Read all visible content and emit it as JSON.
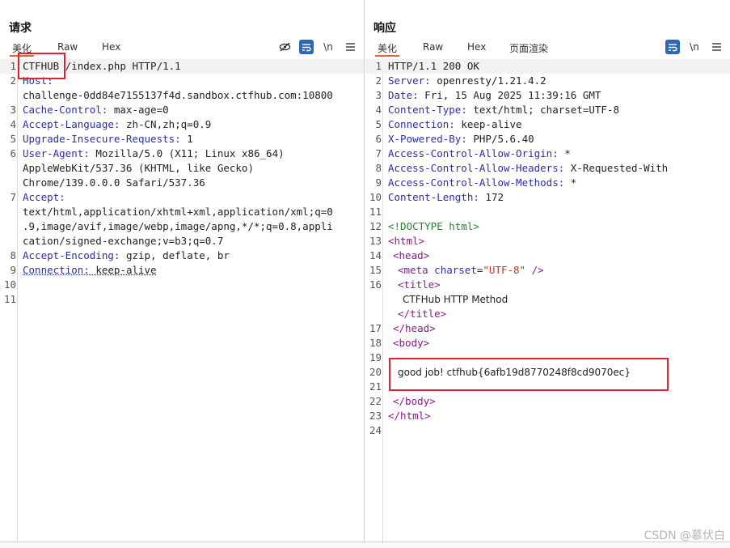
{
  "request": {
    "title": "请求",
    "tabs": [
      "美化",
      "Raw",
      "Hex"
    ],
    "active_tab": "美化",
    "icons": [
      "eye-slash-icon",
      "wrap-icon",
      "newline-icon",
      "menu-icon"
    ],
    "newline_label": "\\n",
    "line_numbers": [
      "1",
      "2",
      "",
      "3",
      "4",
      "5",
      "6",
      "",
      "",
      "7",
      "",
      "",
      "",
      "8",
      "9",
      "10",
      "11"
    ],
    "lines": [
      {
        "k": "",
        "v": "CTFHUB /index.php HTTP/1.1"
      },
      {
        "k": "Host:",
        "v": ""
      },
      {
        "k": "",
        "v": "challenge-0dd84e7155137f4d.sandbox.ctfhub.com:10800"
      },
      {
        "k": "Cache-Control:",
        "v": " max-age=0"
      },
      {
        "k": "Accept-Language:",
        "v": " zh-CN,zh;q=0.9"
      },
      {
        "k": "Upgrade-Insecure-Requests:",
        "v": " 1"
      },
      {
        "k": "User-Agent:",
        "v": " Mozilla/5.0 (X11; Linux x86_64)"
      },
      {
        "k": "",
        "v": "AppleWebKit/537.36 (KHTML, like Gecko)"
      },
      {
        "k": "",
        "v": "Chrome/139.0.0.0 Safari/537.36"
      },
      {
        "k": "Accept:",
        "v": ""
      },
      {
        "k": "",
        "v": "text/html,application/xhtml+xml,application/xml;q=0"
      },
      {
        "k": "",
        "v": ".9,image/avif,image/webp,image/apng,*/*;q=0.8,appli"
      },
      {
        "k": "",
        "v": "cation/signed-exchange;v=b3;q=0.7"
      },
      {
        "k": "Accept-Encoding:",
        "v": " gzip, deflate, br"
      },
      {
        "k": "Connection:",
        "v": " keep-alive"
      },
      {
        "k": "",
        "v": ""
      },
      {
        "k": "",
        "v": ""
      }
    ]
  },
  "response": {
    "title": "响应",
    "tabs": [
      "美化",
      "Raw",
      "Hex",
      "页面渲染"
    ],
    "active_tab": "美化",
    "icons": [
      "wrap-icon",
      "newline-icon",
      "menu-icon"
    ],
    "newline_label": "\\n",
    "headers": [
      {
        "n": "1",
        "k": "",
        "v": "HTTP/1.1 200 OK"
      },
      {
        "n": "2",
        "k": "Server:",
        "v": " openresty/1.21.4.2"
      },
      {
        "n": "3",
        "k": "Date:",
        "v": " Fri, 15 Aug 2025 11:39:16 GMT"
      },
      {
        "n": "4",
        "k": "Content-Type:",
        "v": " text/html; charset=UTF-8"
      },
      {
        "n": "5",
        "k": "Connection:",
        "v": " keep-alive"
      },
      {
        "n": "6",
        "k": "X-Powered-By:",
        "v": " PHP/5.6.40"
      },
      {
        "n": "7",
        "k": "Access-Control-Allow-Origin:",
        "v": " *"
      },
      {
        "n": "8",
        "k": "Access-Control-Allow-Headers:",
        "v": " X-Requested-With"
      },
      {
        "n": "9",
        "k": "Access-Control-Allow-Methods:",
        "v": " *"
      },
      {
        "n": "10",
        "k": "Content-Length:",
        "v": " 172"
      },
      {
        "n": "11",
        "k": "",
        "v": ""
      }
    ],
    "html_lines": {
      "doctype": "<!DOCTYPE html>",
      "html_open": "<html>",
      "head_open": "<head>",
      "meta_tag": "<meta",
      "meta_attr": "charset",
      "meta_eq": "=",
      "meta_val": "\"UTF-8\"",
      "meta_close": " />",
      "title_open": "<title>",
      "title_text": "CTFHub HTTP Method",
      "title_close": "</title>",
      "head_close": "</head>",
      "body_open": "<body>",
      "body_text": "good job! ctfhub{6afb19d8770248f8cd9070ec}",
      "body_close": "</body>",
      "html_close": "</html>"
    },
    "html_line_numbers": [
      "12",
      "13",
      "14",
      "15",
      "16",
      "",
      "",
      "17",
      "18",
      "19",
      "20",
      "21",
      "22",
      "23",
      "24"
    ]
  },
  "watermark": "CSDN @慕伏白"
}
